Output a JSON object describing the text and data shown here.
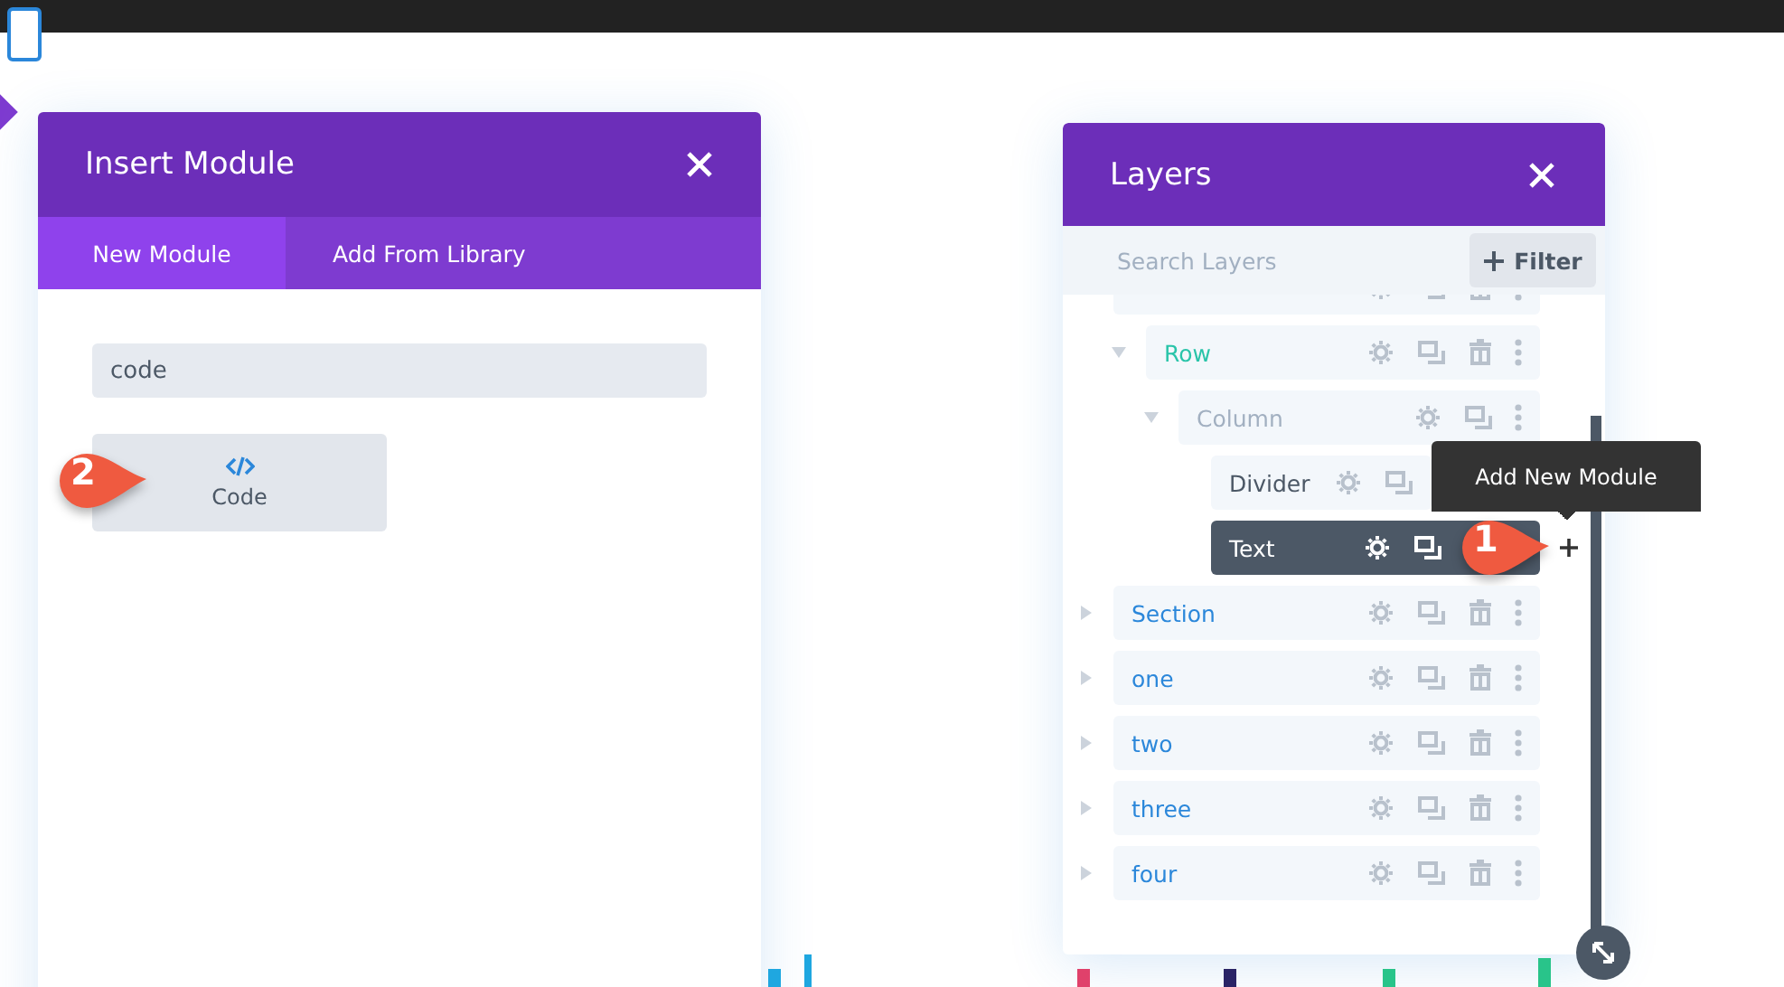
{
  "insert_module": {
    "title": "Insert Module",
    "tabs": [
      {
        "label": "New Module",
        "selected": true
      },
      {
        "label": "Add From Library",
        "selected": false
      }
    ],
    "search": {
      "value": "code"
    },
    "results": [
      {
        "label": "Code",
        "callout": "2"
      }
    ]
  },
  "layers": {
    "title": "Layers",
    "search": {
      "placeholder": "Search Layers"
    },
    "filter_button": "Filter",
    "tree": [
      {
        "kind": "section",
        "children": [
          {
            "label": "Row",
            "kind": "row",
            "expanded": true,
            "children": [
              {
                "label": "Column",
                "kind": "column",
                "expanded": true,
                "children": [
                  {
                    "label": "Divider",
                    "kind": "module",
                    "selected": false
                  },
                  {
                    "label": "Text",
                    "kind": "module",
                    "selected": true,
                    "callout": "1"
                  }
                ]
              }
            ]
          }
        ]
      },
      {
        "label": "Section",
        "kind": "section",
        "expanded": false
      },
      {
        "label": "one",
        "kind": "section",
        "expanded": false
      },
      {
        "label": "two",
        "kind": "section",
        "expanded": false
      },
      {
        "label": "three",
        "kind": "section",
        "expanded": false
      },
      {
        "label": "four",
        "kind": "section",
        "expanded": false
      }
    ],
    "tooltip": "Add New Module"
  }
}
